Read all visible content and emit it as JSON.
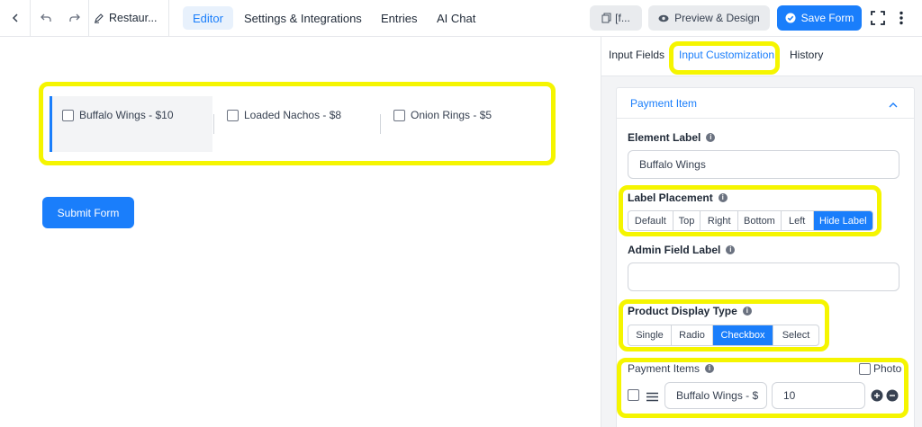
{
  "topbar": {
    "form_title": "Restaur...",
    "tabs": [
      "Editor",
      "Settings & Integrations",
      "Entries",
      "AI Chat"
    ],
    "shortcode_label": "[f...",
    "preview_label": "Preview & Design",
    "save_label": "Save Form"
  },
  "canvas": {
    "items": [
      "Buffalo Wings - $10",
      "Loaded Nachos - $8",
      "Onion Rings - $5"
    ],
    "submit_label": "Submit Form"
  },
  "panel": {
    "tabs": [
      "Input Fields",
      "Input Customization",
      "History"
    ],
    "section_title": "Payment Item",
    "element_label": {
      "label": "Element Label",
      "value": "Buffalo Wings"
    },
    "label_placement": {
      "label": "Label Placement",
      "options": [
        "Default",
        "Top",
        "Right",
        "Bottom",
        "Left",
        "Hide Label"
      ],
      "selected": "Hide Label"
    },
    "admin_label": {
      "label": "Admin Field Label",
      "value": ""
    },
    "display_type": {
      "label": "Product Display Type",
      "options": [
        "Single",
        "Radio",
        "Checkbox",
        "Select"
      ],
      "selected": "Checkbox"
    },
    "payment_items": {
      "label": "Payment Items",
      "photo_label": "Photo",
      "row": {
        "name": "Buffalo Wings - $",
        "price": "10"
      }
    }
  },
  "colors": {
    "accent": "#1a7efb",
    "highlight": "#f5f500"
  }
}
